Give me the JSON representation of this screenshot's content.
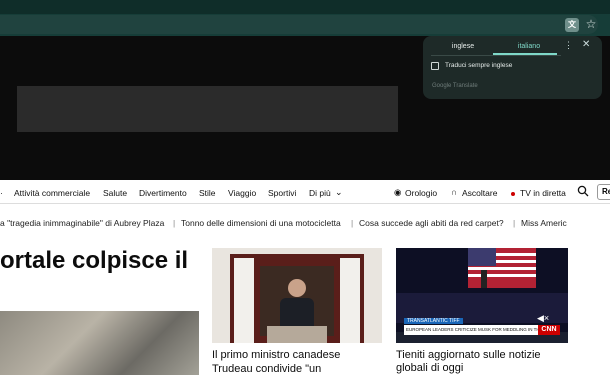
{
  "browser": {
    "translate_icon": "translate-icon",
    "bookmark_icon": "star-icon"
  },
  "translate_popup": {
    "tab_source": "inglese",
    "tab_target": "italiano",
    "more_icon": "more-vert-icon",
    "close_icon": "close-icon",
    "always_translate_label": "Traduci sempre inglese",
    "footer": "Google Translate"
  },
  "nav": {
    "items": [
      "Attività commerciale",
      "Salute",
      "Divertimento",
      "Stile",
      "Viaggio",
      "Sportivi",
      "Di più"
    ],
    "right": [
      "Orologio",
      "Ascoltare",
      "TV in diretta"
    ],
    "button": "Re"
  },
  "ticker": {
    "items": [
      "a \"tragedia inimmaginabile\" di Aubrey Plaza",
      "Tonno delle dimensioni di una motocicletta",
      "Cosa succede agli abiti da red carpet?",
      "Miss Americ"
    ]
  },
  "main": {
    "headline": "ortale colpisce il",
    "story2_line1": "Il primo ministro canadese",
    "story2_line2": "Trudeau condivide \"un",
    "story3_line1": "Tieniti aggiornato sulle notizie",
    "story3_line2": "globali di oggi",
    "video_banner_top": "TRANSATLANTIC TIFF",
    "video_banner": "EUROPEAN LEADERS CRITICIZE MUSK FOR MEDDLING IN THEIR POLITICS",
    "video_logo": "CNN"
  }
}
